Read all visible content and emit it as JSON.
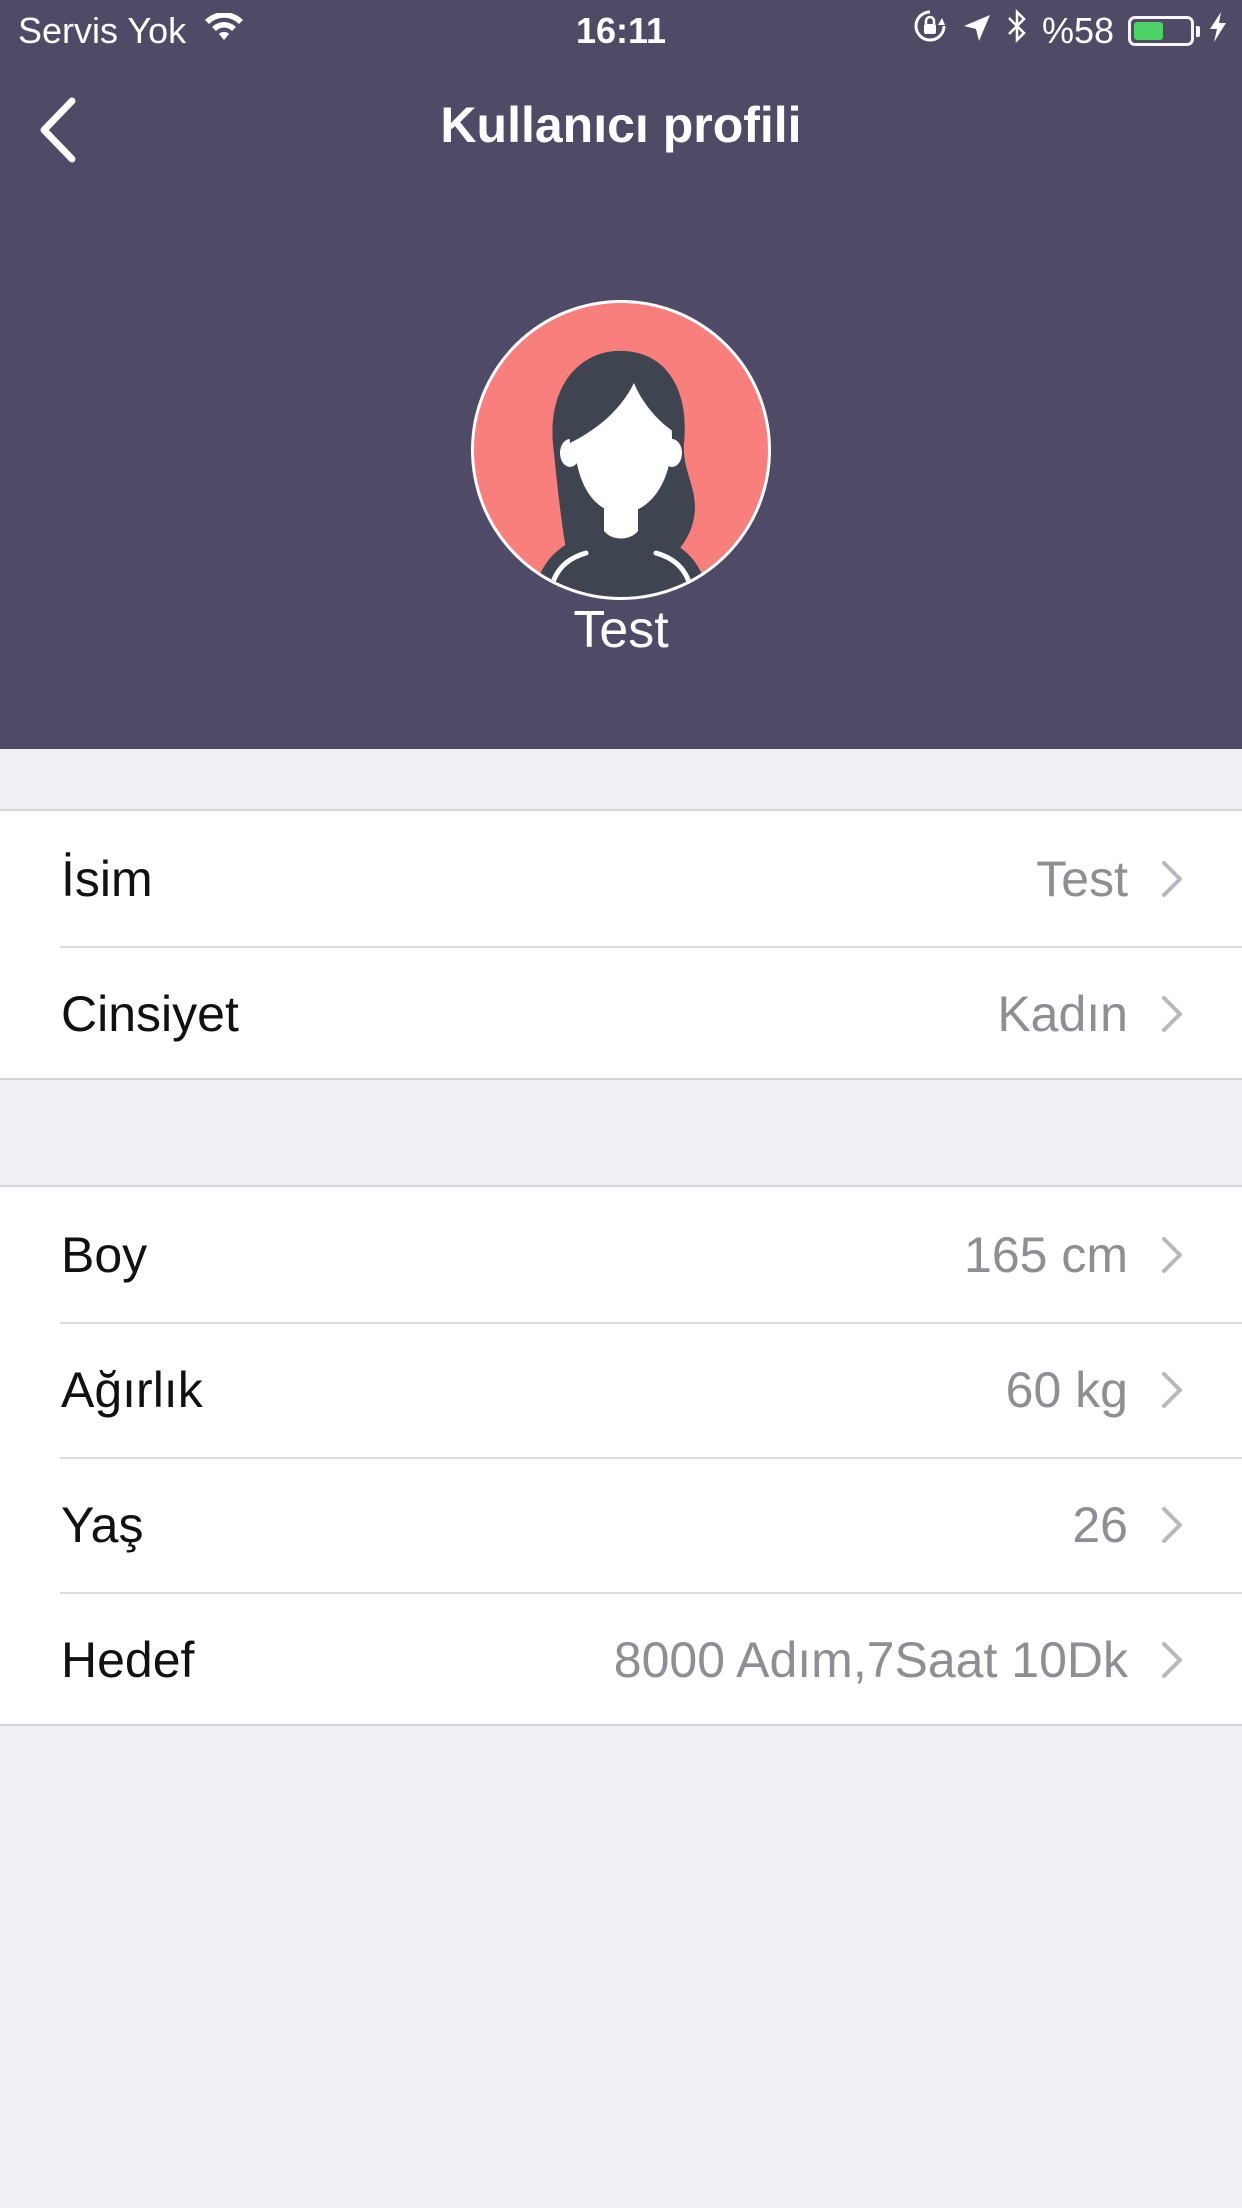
{
  "status_bar": {
    "carrier": "Servis Yok",
    "time": "16:11",
    "battery_percent_label": "%58",
    "battery_level": 0.58,
    "battery_color": "#4CD964"
  },
  "nav": {
    "title": "Kullanıcı profili",
    "back_icon": "chevron-left-icon"
  },
  "profile": {
    "name": "Test",
    "avatar_icon": "female-avatar-icon",
    "avatar_color": "#F87F7C",
    "header_color": "#4F4A66"
  },
  "groups": [
    {
      "rows": [
        {
          "label": "İsim",
          "value": "Test"
        },
        {
          "label": "Cinsiyet",
          "value": "Kadın"
        }
      ]
    },
    {
      "rows": [
        {
          "label": "Boy",
          "value": "165 cm"
        },
        {
          "label": "Ağırlık",
          "value": "60 kg"
        },
        {
          "label": "Yaş",
          "value": "26"
        },
        {
          "label": "Hedef",
          "value": "8000 Adım,7Saat 10Dk"
        }
      ]
    }
  ]
}
